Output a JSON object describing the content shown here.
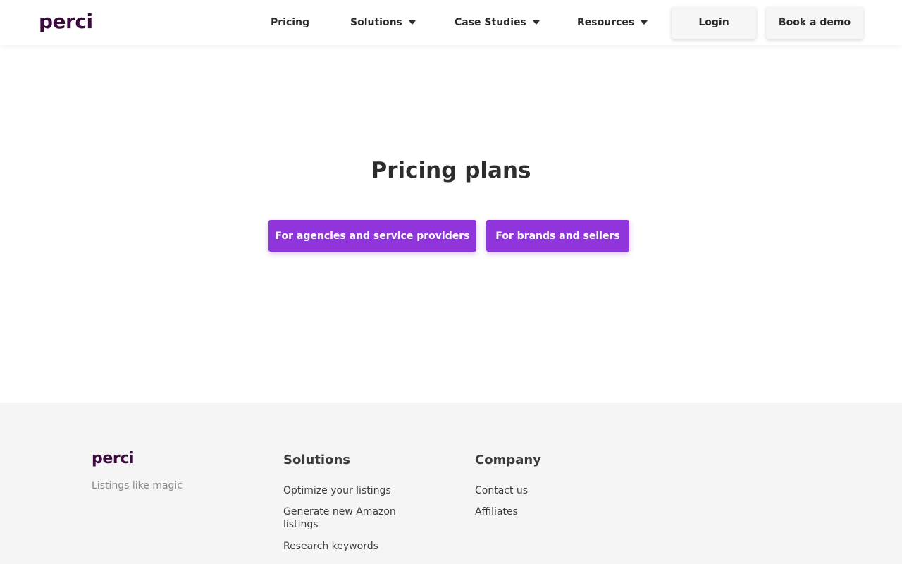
{
  "header": {
    "logo_text": "perci",
    "nav": [
      {
        "label": "Pricing",
        "has_dropdown": false
      },
      {
        "label": "Solutions",
        "has_dropdown": true
      },
      {
        "label": "Case Studies",
        "has_dropdown": true
      },
      {
        "label": "Resources",
        "has_dropdown": true
      }
    ],
    "login_label": "Login",
    "demo_label": "Book a demo"
  },
  "main": {
    "title": "Pricing plans",
    "buttons": [
      {
        "label": "For agencies and service providers"
      },
      {
        "label": "For brands and sellers"
      }
    ]
  },
  "footer": {
    "logo_text": "perci",
    "tagline": "Listings like magic",
    "columns": [
      {
        "heading": "Solutions",
        "links": [
          "Optimize your listings",
          "Generate new Amazon listings",
          "Research keywords"
        ]
      },
      {
        "heading": "Company",
        "links": [
          "Contact us",
          "Affiliates"
        ]
      }
    ]
  },
  "colors": {
    "brand": "#3d0a3f",
    "accent": "#9035dc",
    "footer_bg": "#f5f5f5"
  }
}
